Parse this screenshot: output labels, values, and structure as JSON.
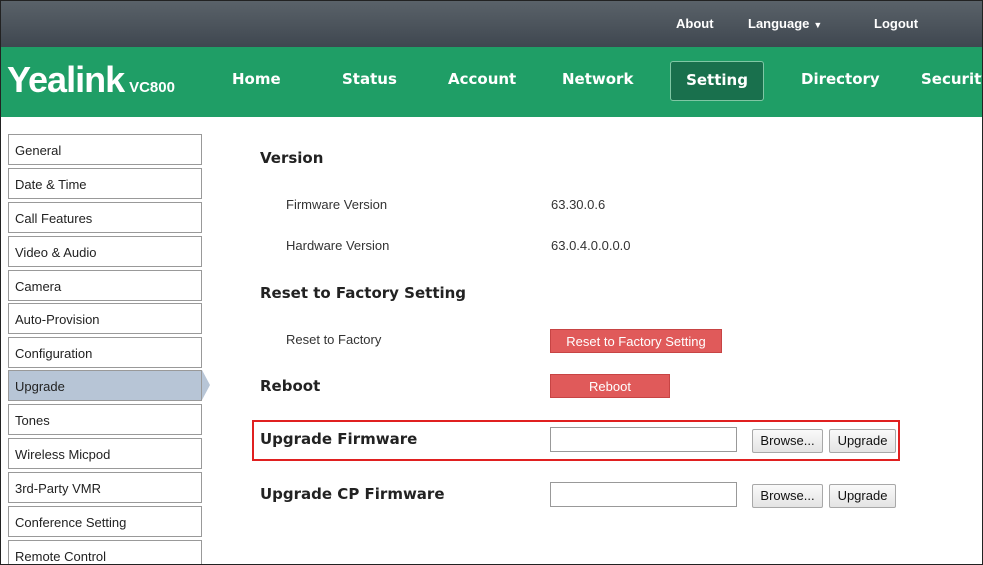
{
  "topbar": {
    "about": "About",
    "language": "Language",
    "logout": "Logout"
  },
  "logo": {
    "brand": "Yealink",
    "model": "VC800"
  },
  "nav": {
    "home": "Home",
    "status": "Status",
    "account": "Account",
    "network": "Network",
    "setting": "Setting",
    "directory": "Directory",
    "security": "Security"
  },
  "sidebar": {
    "items": [
      "General",
      "Date & Time",
      "Call Features",
      "Video & Audio",
      "Camera",
      "Auto-Provision",
      "Configuration",
      "Upgrade",
      "Tones",
      "Wireless Micpod",
      "3rd-Party VMR",
      "Conference Setting",
      "Remote Control"
    ],
    "active": "Upgrade"
  },
  "content": {
    "version_heading": "Version",
    "firmware_label": "Firmware Version",
    "firmware_value": "63.30.0.6",
    "hardware_label": "Hardware Version",
    "hardware_value": "63.0.4.0.0.0.0",
    "reset_heading": "Reset to Factory Setting",
    "reset_label": "Reset to Factory",
    "reset_button": "Reset to Factory Setting",
    "reboot_heading": "Reboot",
    "reboot_button": "Reboot",
    "upgrade_fw_heading": "Upgrade Firmware",
    "upgrade_cp_heading": "Upgrade CP Firmware",
    "browse_button": "Browse...",
    "upgrade_button": "Upgrade"
  }
}
